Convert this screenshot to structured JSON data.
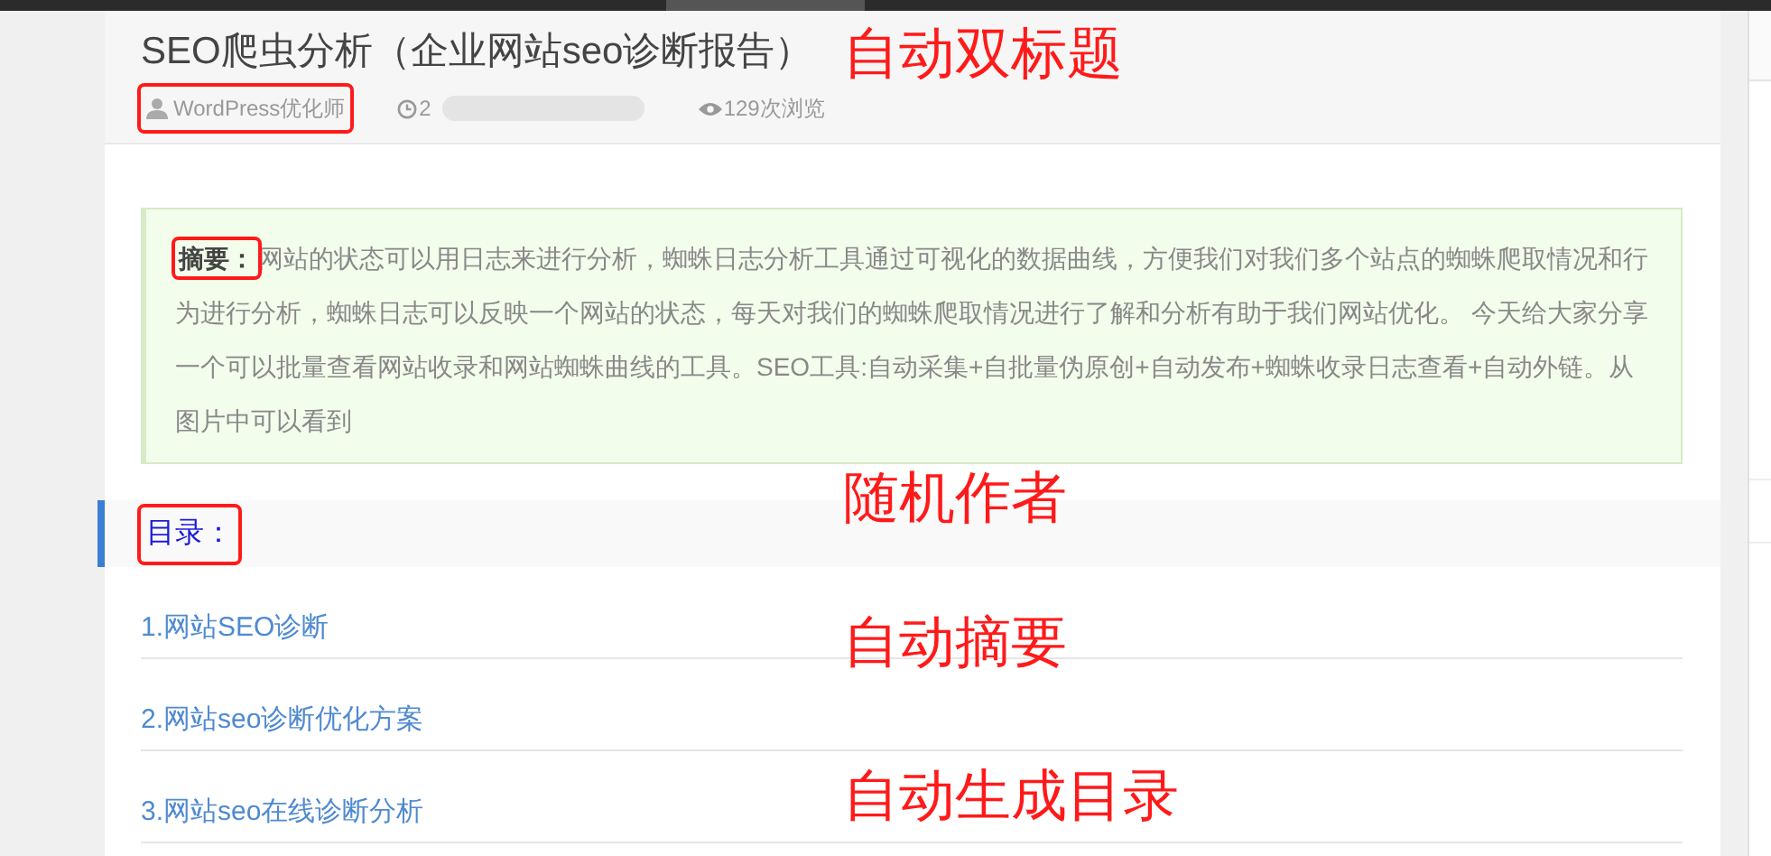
{
  "article": {
    "title": "SEO爬虫分析（企业网站seo诊断报告）",
    "author": "WordPress优化师",
    "author_marked": true,
    "date": "2",
    "views": "129次浏览"
  },
  "summary": {
    "label": "摘要：",
    "label_marked": true,
    "text": "网站的状态可以用日志来进行分析，蜘蛛日志分析工具通过可视化的数据曲线，方便我们对我们多个站点的蜘蛛爬取情况和行为进行分析，蜘蛛日志可以反映一个网站的状态，每天对我们的蜘蛛爬取情况进行了解和分析有助于我们网站优化。 今天给大家分享一个可以批量查看网站收录和网站蜘蛛曲线的工具。SEO工具:自动采集+自批量伪原创+自动发布+蜘蛛收录日志查看+自动外链。从图片中可以看到"
  },
  "toc": {
    "title": "目录：",
    "title_marked": true,
    "items": [
      {
        "label": "1.网站SEO诊断"
      },
      {
        "label": "2.网站seo诊断优化方案"
      },
      {
        "label": "3.网站seo在线诊断分析"
      }
    ]
  },
  "annotations": [
    {
      "text": "自动双标题"
    },
    {
      "text": "随机作者"
    },
    {
      "text": "自动摘要"
    },
    {
      "text": "自动生成目录"
    }
  ]
}
